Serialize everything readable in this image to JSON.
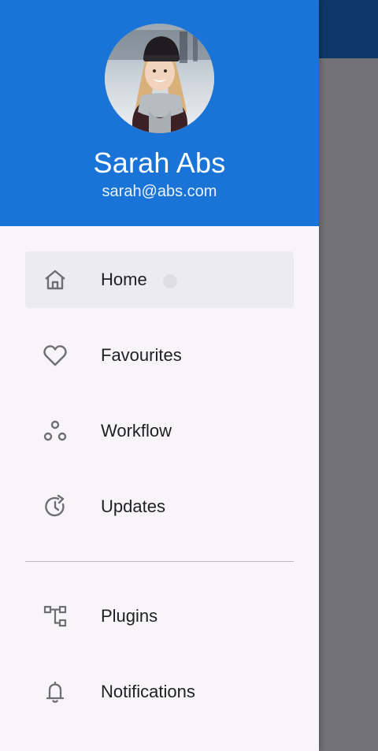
{
  "user": {
    "name": "Sarah Abs",
    "email": "sarah@abs.com"
  },
  "menu": {
    "primary": [
      {
        "label": "Home",
        "icon": "home-icon",
        "active": true
      },
      {
        "label": "Favourites",
        "icon": "heart-icon",
        "active": false
      },
      {
        "label": "Workflow",
        "icon": "workflow-icon",
        "active": false
      },
      {
        "label": "Updates",
        "icon": "updates-icon",
        "active": false
      }
    ],
    "secondary": [
      {
        "label": "Plugins",
        "icon": "plugins-icon",
        "active": false
      },
      {
        "label": "Notifications",
        "icon": "bell-icon",
        "active": false
      }
    ]
  },
  "colors": {
    "header": "#1a74d8",
    "scrim": "#737276",
    "appbar": "#0c3768",
    "drawer": "#f7f5f9",
    "active_item": "#ecebef",
    "icon": "#6f6e73",
    "text": "#1f1f22"
  }
}
